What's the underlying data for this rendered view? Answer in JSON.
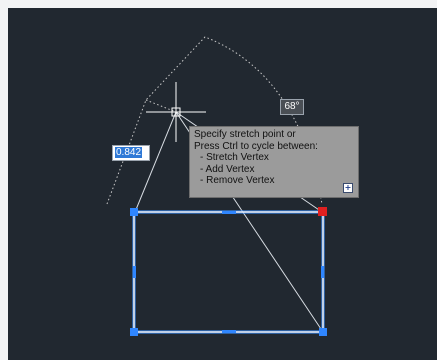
{
  "dynamic_input": {
    "value": "0.842"
  },
  "angle_readout": {
    "value": "68°"
  },
  "tooltip": {
    "title_line1": "Specify stretch point or",
    "title_line2": "Press Ctrl to cycle between:",
    "options": [
      "- Stretch Vertex",
      "- Add Vertex",
      "- Remove Vertex"
    ],
    "expand_glyph": "+"
  },
  "colors": {
    "canvas_bg": "#212830",
    "polyline": "#e6eef8",
    "grip_selected": "#2f86ff",
    "grip_hot": "#e02020",
    "dimension": "#c9c9c9"
  },
  "icons": {
    "crosshair": "crosshair-cursor-icon",
    "grip": "square-grip-icon",
    "expand": "expand-plus-icon"
  }
}
